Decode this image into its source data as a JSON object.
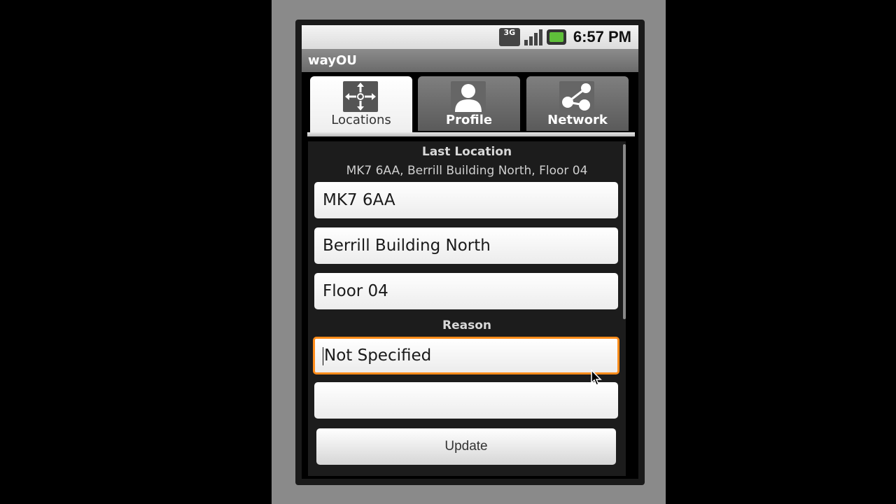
{
  "status_bar": {
    "network_badge": "3G",
    "time": "6:57 PM"
  },
  "app": {
    "title": "wayOU"
  },
  "tabs": [
    {
      "label": "Locations",
      "icon": "arrows-crosshair-icon",
      "active": true
    },
    {
      "label": "Profile",
      "icon": "person-icon",
      "active": false
    },
    {
      "label": "Network",
      "icon": "network-nodes-icon",
      "active": false
    }
  ],
  "locations": {
    "last_location_heading": "Last Location",
    "last_location_summary": "MK7 6AA, Berrill Building North, Floor 04",
    "postcode": "MK7 6AA",
    "building": "Berrill Building North",
    "floor": "Floor 04",
    "reason_heading": "Reason",
    "reason_value": "Not Specified",
    "extra_value": "",
    "update_label": "Update"
  },
  "colors": {
    "focus_accent": "#ff8c1a",
    "battery_green": "#5fbf3a"
  }
}
